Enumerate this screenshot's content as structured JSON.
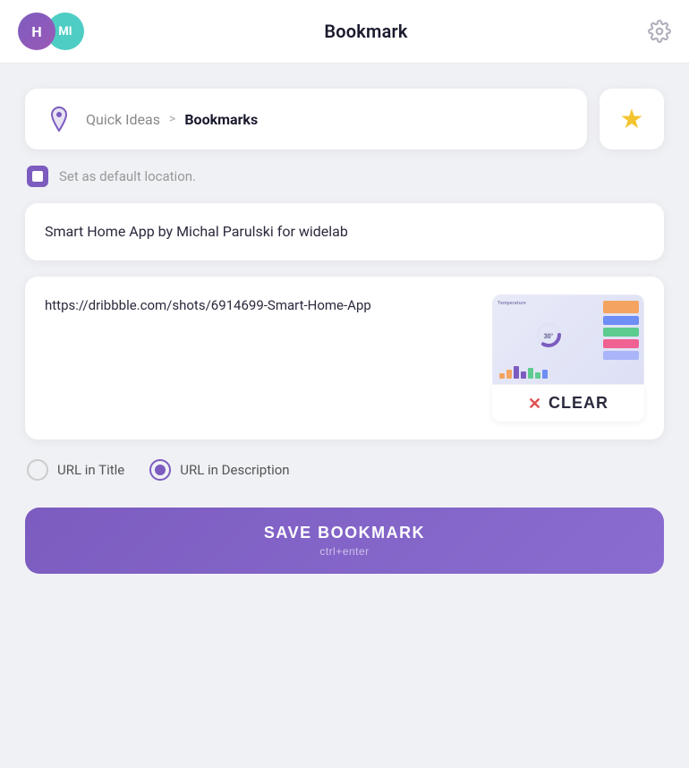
{
  "header": {
    "title": "Bookmark",
    "avatar_h_label": "H",
    "avatar_mi_label": "MI"
  },
  "location": {
    "parent": "Quick Ideas",
    "arrow": ">",
    "current": "Bookmarks"
  },
  "default_location": {
    "label": "Set as default location."
  },
  "title_card": {
    "text": "Smart Home App by Michal Parulski for widelab"
  },
  "url_card": {
    "url": "https://dribbble.com/shots/6914699-Smart-Home-App"
  },
  "clear_button": {
    "label": "CLEAR"
  },
  "radio": {
    "option1": "URL in Title",
    "option2": "URL in Description"
  },
  "save_button": {
    "label": "SAVE BOOKMARK",
    "shortcut": "ctrl+enter"
  },
  "colors": {
    "accent": "#7c5cbf",
    "star": "#f4c430",
    "clear_x": "#e05050"
  }
}
